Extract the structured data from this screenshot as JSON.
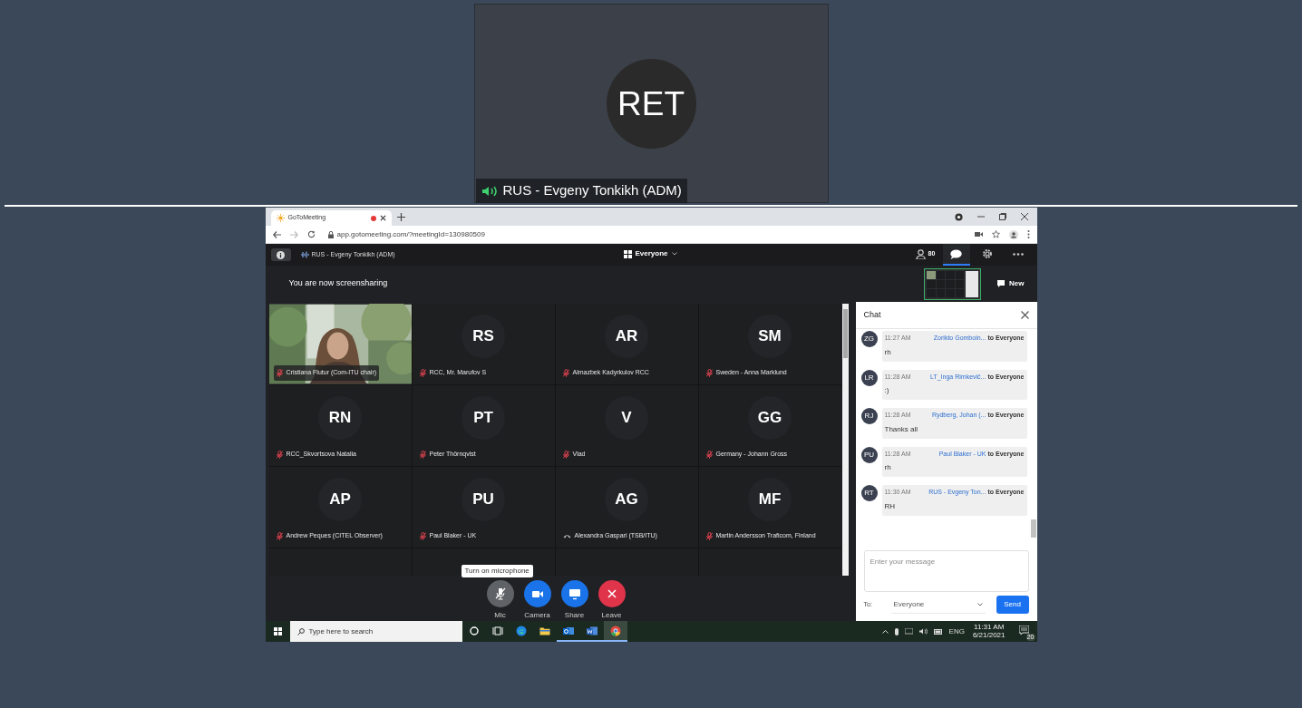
{
  "top_tile": {
    "initials": "RET",
    "name": "RUS - Evgeny Tonkikh (ADM)",
    "speaking": true
  },
  "browser": {
    "tab_title": "GoToMeeting",
    "recording": true,
    "url": "app.gotomeeting.com/?meetingId=130980509"
  },
  "meeting_header": {
    "presenter": "RUS - Evgeny Tonkikh (ADM)",
    "view": "Everyone",
    "buttons": [
      {
        "kind": "attendees",
        "count": "80",
        "selected": false
      },
      {
        "kind": "chat",
        "selected": true
      },
      {
        "kind": "settings",
        "selected": false
      },
      {
        "kind": "more",
        "selected": false
      }
    ]
  },
  "banner": "You are now screensharing",
  "new_label": "New",
  "participants": [
    {
      "kind": "video",
      "name": "Cristiana Flutur (Com-ITU chair)",
      "on_phone": false
    },
    {
      "kind": "initials",
      "initials": "RS",
      "name": "RCC, Mr. Marufov S",
      "on_phone": false
    },
    {
      "kind": "initials",
      "initials": "AR",
      "name": "Almazbek Kadyrkulov RCC",
      "on_phone": false
    },
    {
      "kind": "initials",
      "initials": "SM",
      "name": "Sweden - Anna Marklund",
      "on_phone": false
    },
    {
      "kind": "initials",
      "initials": "RN",
      "name": "RCC_Skvortsova Natalia",
      "on_phone": false
    },
    {
      "kind": "initials",
      "initials": "PT",
      "name": "Peter Thörnqvist",
      "on_phone": false
    },
    {
      "kind": "initials",
      "initials": "V",
      "name": "Vlad",
      "on_phone": false
    },
    {
      "kind": "initials",
      "initials": "GG",
      "name": "Germany - Johann Gross",
      "on_phone": false
    },
    {
      "kind": "initials",
      "initials": "AP",
      "name": "Andrew Peques (CITEL Observer)",
      "on_phone": false
    },
    {
      "kind": "initials",
      "initials": "PU",
      "name": "Paul Blaker - UK",
      "on_phone": false
    },
    {
      "kind": "initials",
      "initials": "AG",
      "name": "Alexandra Gaspari (TSB/ITU)",
      "on_phone": true
    },
    {
      "kind": "initials",
      "initials": "MF",
      "name": "Martin Andersson Traficom, Finland",
      "on_phone": false
    }
  ],
  "controls": {
    "tooltip": "Turn on microphone",
    "buttons": [
      {
        "kind": "mic",
        "label": "Mic",
        "on": false
      },
      {
        "kind": "camera",
        "label": "Camera"
      },
      {
        "kind": "share",
        "label": "Share"
      },
      {
        "kind": "leave",
        "label": "Leave"
      }
    ]
  },
  "chat": {
    "title": "Chat",
    "messages": [
      {
        "initials": "ZG",
        "time": "11:27 AM",
        "sender": "Zorikto Gomboin...",
        "to": "to Everyone",
        "text": "rh"
      },
      {
        "initials": "LR",
        "time": "11:28 AM",
        "sender": "LT_Inga Rimkevič...",
        "to": "to Everyone",
        "text": ":)"
      },
      {
        "initials": "RJ",
        "time": "11:28 AM",
        "sender": "Rydberg, Johan (...",
        "to": "to Everyone",
        "text": "Thanks all"
      },
      {
        "initials": "PU",
        "time": "11:28 AM",
        "sender": "Paul Blaker - UK",
        "to": "to Everyone",
        "text": "rh"
      },
      {
        "initials": "RT",
        "time": "11:30 AM",
        "sender": "RUS - Evgeny Ton...",
        "to": "to Everyone",
        "text": "RH"
      }
    ],
    "placeholder": "Enter your message",
    "to_label": "To:",
    "recipient": "Everyone",
    "send": "Send"
  },
  "taskbar": {
    "search_placeholder": "Type here to search",
    "apps": [
      {
        "kind": "cortana",
        "running": false,
        "selected": false
      },
      {
        "kind": "taskview",
        "running": false,
        "selected": false
      },
      {
        "kind": "edge",
        "running": false,
        "selected": false
      },
      {
        "kind": "explorer",
        "running": false,
        "selected": false
      },
      {
        "kind": "outlook",
        "running": true,
        "selected": false
      },
      {
        "kind": "word",
        "running": true,
        "selected": false
      },
      {
        "kind": "chrome",
        "running": true,
        "selected": true
      }
    ],
    "language": "ENG",
    "time": "11:31 AM",
    "date": "6/21/2021",
    "notifications": "20"
  }
}
